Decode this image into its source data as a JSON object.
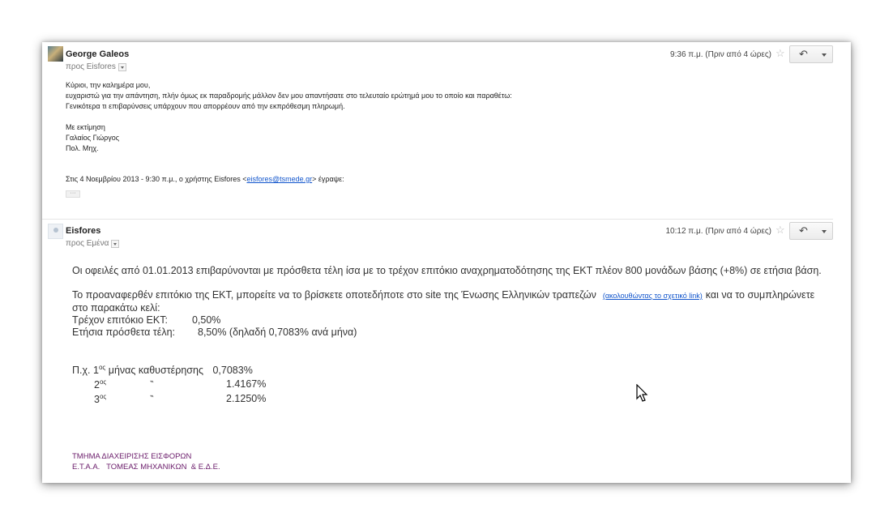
{
  "message1": {
    "sender": "George Galeos",
    "recipient": "προς Eisfores",
    "time": "9:36 π.μ. (Πριν από 4 ώρες)",
    "body": [
      "Κύριοι, την καλημέρα μου,",
      "ευχαριστώ για την απάντηση, πλήν όμως εκ παραδρομής μάλλον δεν μου απαντήσατε στο τελευταίο ερώτημά μου το οποίο και παραθέτω:",
      "Γενικότερα τι επιβαρύνσεις υπάρχουν που απορρέουν από την εκπρόθεσμη πληρωμή."
    ],
    "closing": [
      "Με εκτίμηση",
      "Γαλαίος Γιώργος",
      "Πολ. Μηχ."
    ],
    "quote_prefix": "Στις 4 Νοεμβρίου 2013 - 9:30 π.μ., ο χρήστης Eisfores <",
    "quote_email": "eisfores@tsmede.gr",
    "quote_suffix": "> έγραψε:",
    "ellipsis": "···"
  },
  "message2": {
    "sender": "Eisfores",
    "recipient": "προς Εμένα",
    "time": "10:12 π.μ. (Πριν από 4 ώρες)",
    "paragraph1": "Οι οφειλές από 01.01.2013 επιβαρύνονται με πρόσθετα τέλη ίσα με το τρέχον επιτόκιο αναχρηματοδότησης της ΕΚΤ πλέον 800 μονάδων βάσης (+8%) σε ετήσια βάση.",
    "paragraph2_start": "Το προαναφερθέν επιτόκιο της ΕΚΤ, μπορείτε να το βρίσκετε οποτεδήποτε στο site της Ένωσης Ελληνικών τραπεζών",
    "paragraph2_link": "(ακολουθώντας το σχετικό link)",
    "paragraph2_end": "και να το συμπληρώνετε στο παρακάτω κελί:",
    "current_rate_label": "Τρέχον επιτόκιο ΕΚΤ:",
    "current_rate_value": "0,50%",
    "annual_fee_label": "Ετήσια πρόσθετα τέλη:",
    "annual_fee_value": "8,50% (δηλαδή 0,7083% ανά μήνα)",
    "example": [
      {
        "num": "Π.χ. 1",
        "sup": "ος",
        "desc": "μήνας καθυστέρησης",
        "value": "0,7083%"
      },
      {
        "num": "2",
        "sup": "ος",
        "desc": "‶",
        "value": "1.4167%"
      },
      {
        "num": "3",
        "sup": "ος",
        "desc": "‶",
        "value": "2.1250%"
      }
    ],
    "signature": [
      "ΤΜΗΜΑ ΔΙΑΧΕΙΡΙΣΗΣ ΕΙΣΦΟΡΩΝ",
      "Ε.Τ.Α.Α.   ΤΟΜΕΑΣ ΜΗΧΑΝΙΚΩΝ  & Ε.Δ.Ε."
    ]
  },
  "icons": {
    "star": "☆",
    "reply": "⟲"
  }
}
